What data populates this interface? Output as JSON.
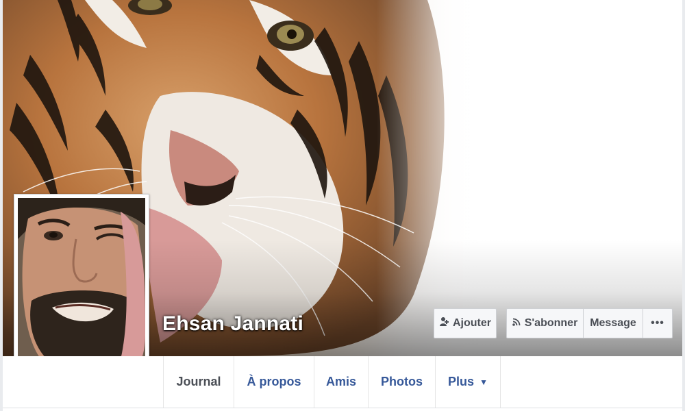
{
  "profile": {
    "name": "Ehsan Jannati"
  },
  "actions": {
    "add_friend": {
      "label": "Ajouter",
      "icon": "add-friend-icon"
    },
    "follow": {
      "label": "S'abonner",
      "icon": "rss-icon"
    },
    "message": {
      "label": "Message"
    },
    "more": {
      "label": "•••"
    }
  },
  "tabs": [
    {
      "label": "Journal",
      "active": true
    },
    {
      "label": "À propos"
    },
    {
      "label": "Amis"
    },
    {
      "label": "Photos"
    },
    {
      "label": "Plus",
      "icon": "caret-down-icon"
    }
  ],
  "colors": {
    "link_blue": "#365899",
    "button_bg": "#f6f7f9",
    "button_text": "#4b4f56"
  }
}
